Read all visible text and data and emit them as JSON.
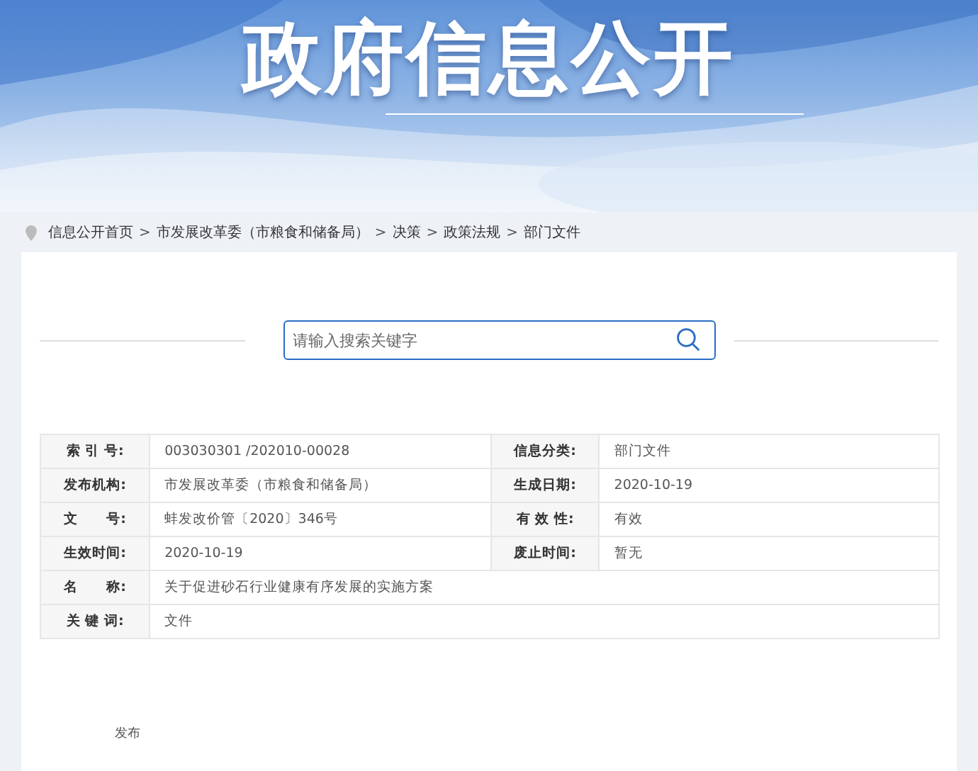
{
  "banner": {
    "title": "政府信息公开"
  },
  "breadcrumb": [
    "信息公开首页",
    "市发展改革委（市粮食和储备局）",
    "决策",
    "政策法规",
    "部门文件"
  ],
  "breadcrumb_separator": ">",
  "search": {
    "placeholder": "请输入搜索关键字"
  },
  "info_table": [
    [
      {
        "label": "索 引 号:",
        "value": "003030301 /202010-00028"
      },
      {
        "label": "信息分类:",
        "value": "部门文件"
      }
    ],
    [
      {
        "label": "发布机构:",
        "value": "市发展改革委（市粮食和储备局）"
      },
      {
        "label": "生成日期:",
        "value": "2020-10-19"
      }
    ],
    [
      {
        "label": "文　　号:",
        "value": "蚌发改价管〔2020〕346号"
      },
      {
        "label": "有 效 性:",
        "value": "有效"
      }
    ],
    [
      {
        "label": "生效时间:",
        "value": "2020-10-19"
      },
      {
        "label": "废止时间:",
        "value": "暂无"
      }
    ],
    [
      {
        "label": "名　　称:",
        "value": "关于促进砂石行业健康有序发展的实施方案"
      }
    ],
    [
      {
        "label": "关 键 词:",
        "value": "文件"
      }
    ]
  ],
  "footer_label": "发布"
}
